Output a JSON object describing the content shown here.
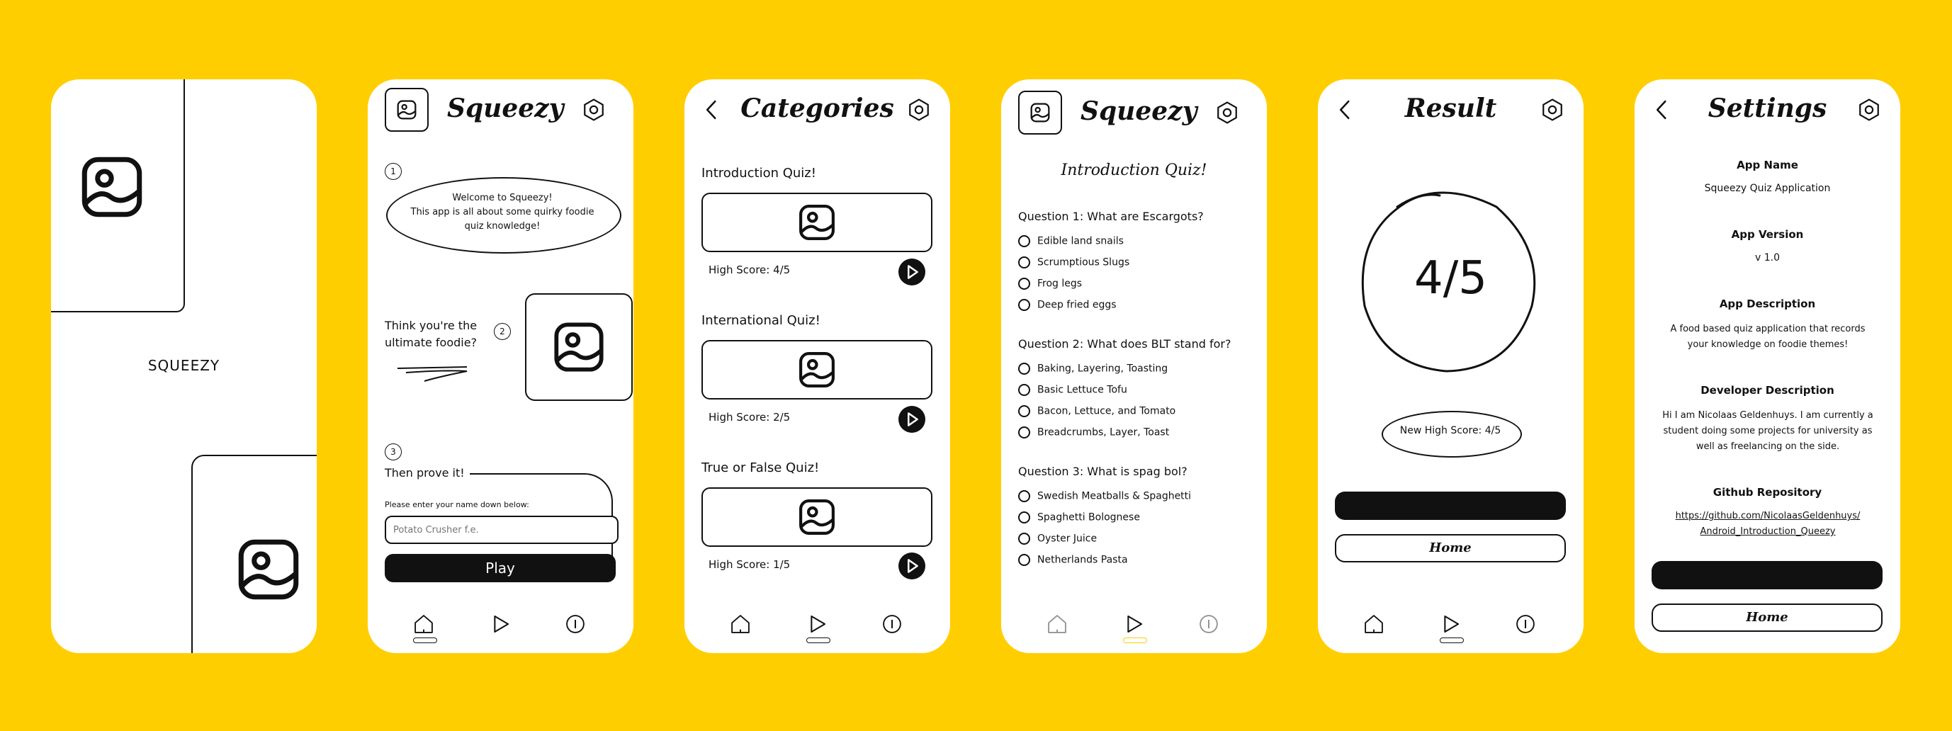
{
  "colors": {
    "background": "#FFCE00",
    "ink": "#111111",
    "accent": "#FFCE00"
  },
  "icons": {
    "image": "image-placeholder-icon",
    "settings": "hexagon-settings-icon",
    "back": "back-chevron-icon",
    "home": "home-icon",
    "play": "play-icon",
    "info": "info-icon"
  },
  "splash": {
    "title": "SQUEEZY"
  },
  "welcome": {
    "app_title": "Squeezy",
    "step1_number": "1",
    "step1_title": "Welcome to Squeezy!",
    "step1_text": "This app is all about some quirky foodie quiz knowledge!",
    "step2_number": "2",
    "step2_text": "Think you're the ultimate foodie?",
    "step3_number": "3",
    "step3_title": "Then prove it!",
    "name_label": "Please enter your name down below:",
    "name_placeholder": "Potato Crusher f.e.",
    "play_label": "Play"
  },
  "categories": {
    "title": "Categories",
    "items": [
      {
        "title": "Introduction Quiz!",
        "high_score": "High Score: 4/5"
      },
      {
        "title": "International Quiz!",
        "high_score": "High Score: 2/5"
      },
      {
        "title": "True or False Quiz!",
        "high_score": "High Score: 1/5"
      }
    ]
  },
  "quiz": {
    "app_title": "Squeezy",
    "quiz_title": "Introduction Quiz!",
    "questions": [
      {
        "text": "Question 1: What are Escargots?",
        "options": [
          "Edible land snails",
          "Scrumptious Slugs",
          "Frog legs",
          "Deep fried eggs"
        ]
      },
      {
        "text": "Question 2: What does BLT stand for?",
        "options": [
          "Baking, Layering, Toasting",
          "Basic Lettuce Tofu",
          "Bacon, Lettuce, and Tomato",
          "Breadcrumbs, Layer, Toast"
        ]
      },
      {
        "text": "Question 3: What is spag bol?",
        "options": [
          "Swedish Meatballs & Spaghetti",
          "Spaghetti Bolognese",
          "Oyster Juice",
          "Netherlands Pasta"
        ]
      }
    ]
  },
  "result": {
    "title": "Result",
    "score": "4/5",
    "new_high_score": "New High Score: 4/5",
    "home_label": "Home"
  },
  "settings": {
    "title": "Settings",
    "app_name_label": "App Name",
    "app_name": "Squeezy Quiz Application",
    "app_version_label": "App Version",
    "app_version": "v 1.0",
    "app_description_label": "App Description",
    "app_description": "A food based quiz application that records your knowledge on foodie themes!",
    "developer_label": "Developer Description",
    "developer_text": "Hi I am Nicolaas Geldenhuys. I am currently a student doing some projects for university as well as freelancing on the side.",
    "github_label": "Github Repository",
    "github_link": "https://github.com/NicolaasGeldenhuys/ Android_Introduction_Queezy",
    "home_label": "Home"
  }
}
